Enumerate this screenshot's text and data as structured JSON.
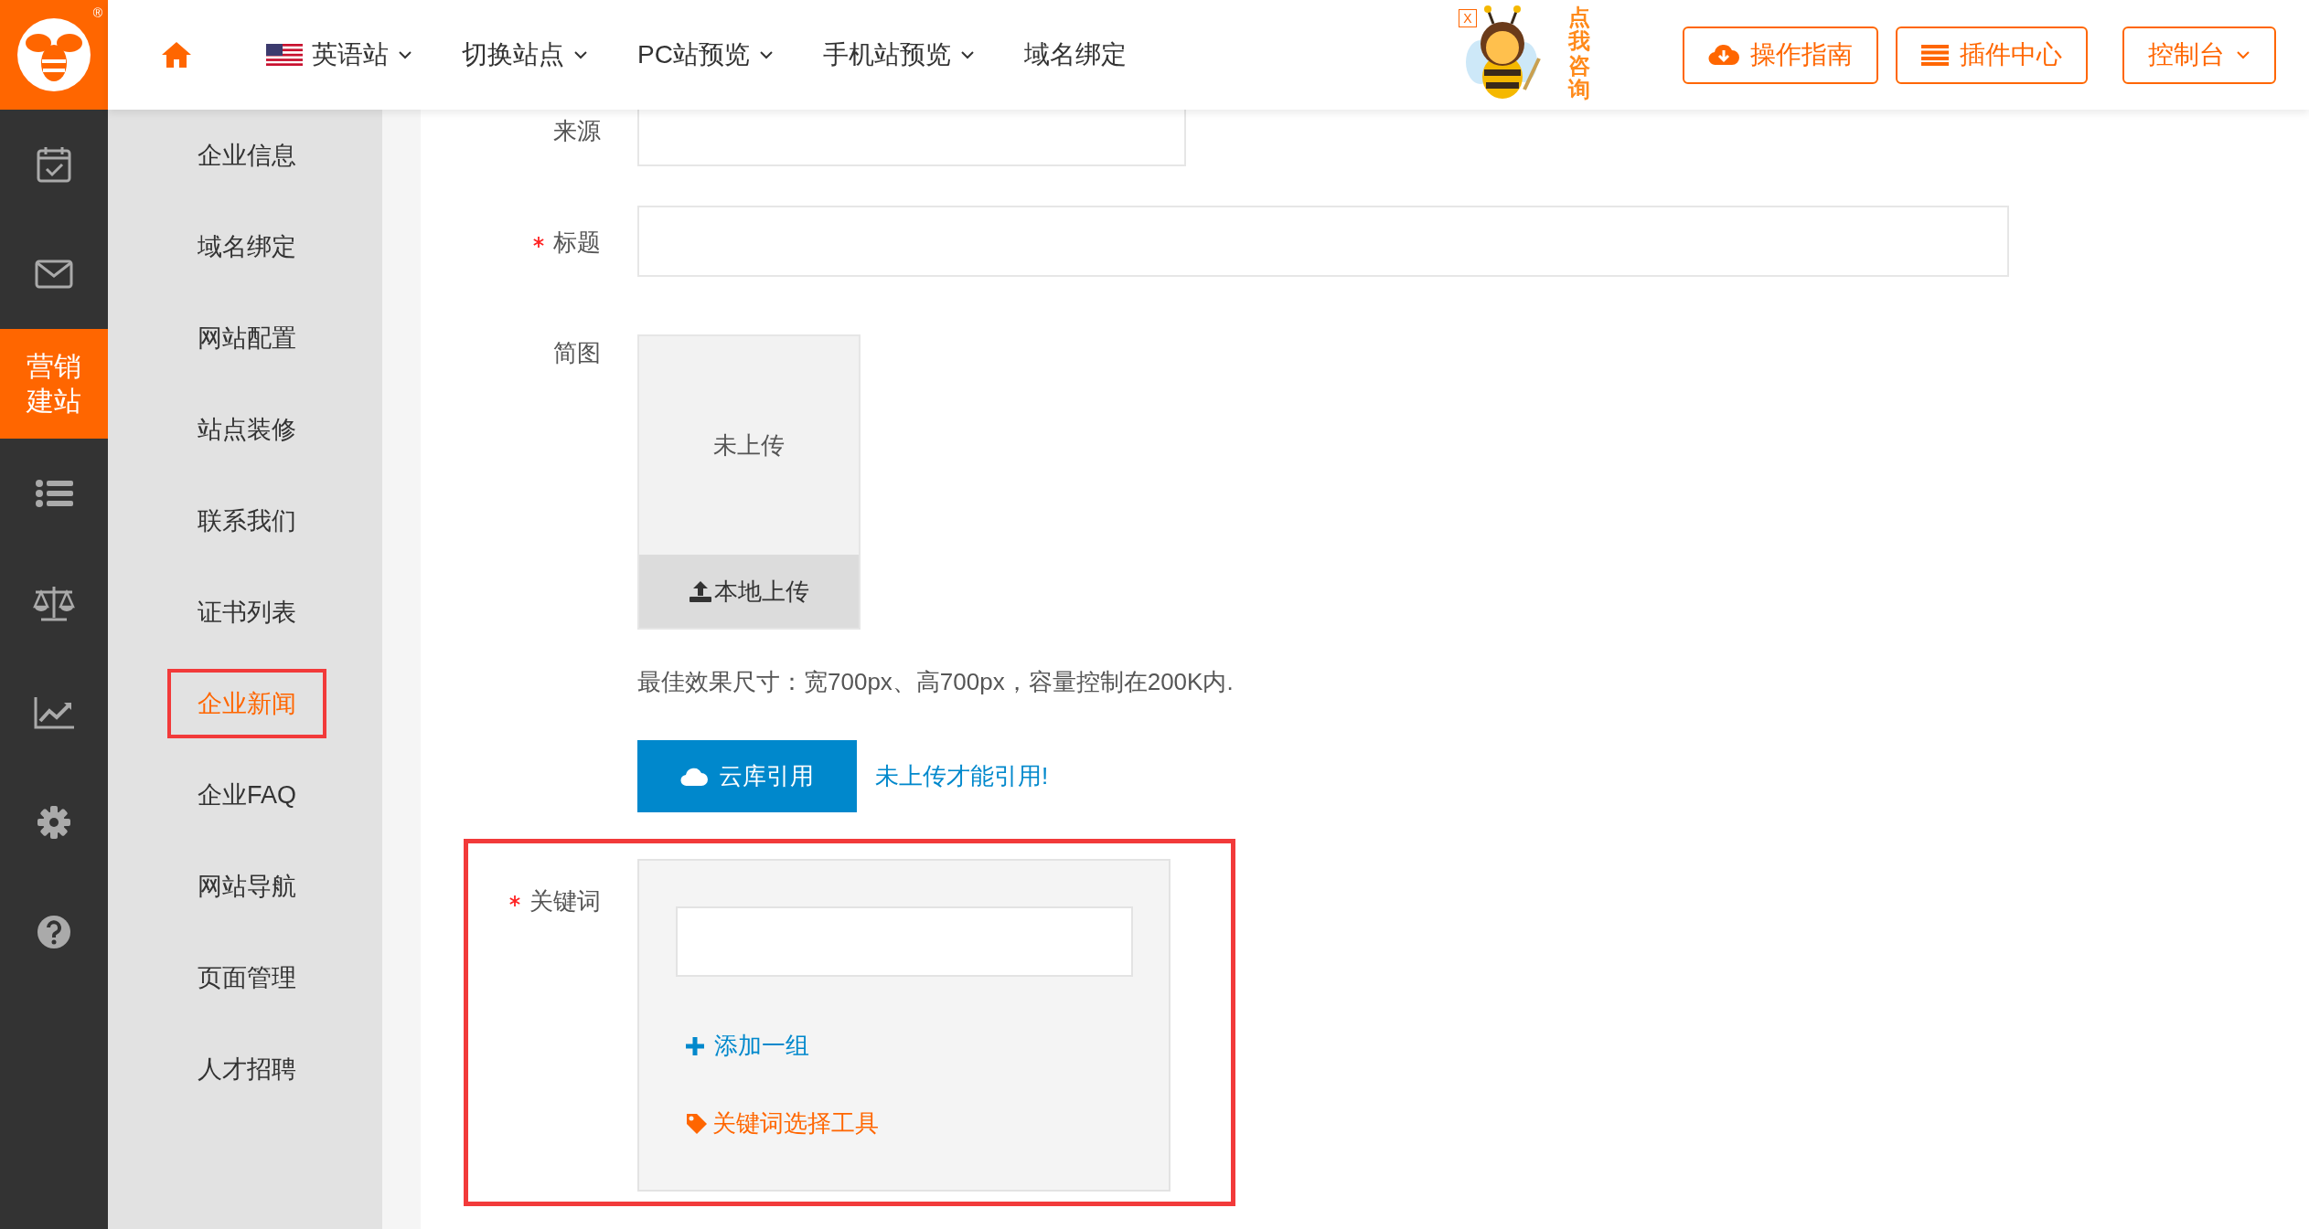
{
  "logo": {
    "mark": "®"
  },
  "rail": {
    "items": [
      {
        "selected": false
      },
      {
        "selected": false
      },
      {
        "label": "营销建站",
        "selected": true
      },
      {
        "selected": false
      },
      {
        "selected": false
      },
      {
        "selected": false
      },
      {
        "selected": false
      },
      {
        "selected": false
      }
    ]
  },
  "nav": {
    "items": [
      {
        "kind": "language",
        "label": "英语站",
        "dropdown": true
      },
      {
        "kind": "plain",
        "label": "切换站点",
        "dropdown": true
      },
      {
        "kind": "plain",
        "label": "PC站预览",
        "dropdown": true
      },
      {
        "kind": "plain",
        "label": "手机站预览",
        "dropdown": true
      },
      {
        "kind": "plain",
        "label": "域名绑定",
        "dropdown": false
      }
    ]
  },
  "consult_badge": {
    "close": "X",
    "text": "点我咨询"
  },
  "header_buttons": [
    {
      "label": "操作指南",
      "dropdown": false
    },
    {
      "label": "插件中心",
      "dropdown": false
    },
    {
      "label": "控制台",
      "dropdown": true
    }
  ],
  "sidebar": {
    "items": [
      {
        "label": "企业信息",
        "selected": false
      },
      {
        "label": "域名绑定",
        "selected": false
      },
      {
        "label": "网站配置",
        "selected": false
      },
      {
        "label": "站点装修",
        "selected": false
      },
      {
        "label": "联系我们",
        "selected": false
      },
      {
        "label": "证书列表",
        "selected": false
      },
      {
        "label": "企业新闻",
        "selected": true
      },
      {
        "label": "企业FAQ",
        "selected": false
      },
      {
        "label": "网站导航",
        "selected": false
      },
      {
        "label": "页面管理",
        "selected": false
      },
      {
        "label": "人才招聘",
        "selected": false
      }
    ]
  },
  "form": {
    "fields": [
      {
        "kind": "short",
        "label": "来源",
        "required": false,
        "highlighted": false
      },
      {
        "kind": "long",
        "label": "标题",
        "required": true,
        "highlighted": false
      },
      {
        "kind": "image",
        "label": "简图",
        "required": false,
        "highlighted": false,
        "empty_text": "未上传",
        "upload_button": "本地上传",
        "hint": "最佳效果尺寸：宽700px、高700px，容量控制在200K内.",
        "cloud_button": "云库引用",
        "cloud_note": "未上传才能引用!"
      },
      {
        "kind": "keywords",
        "label": "关键词",
        "required": true,
        "highlighted": true,
        "add_link": "添加一组",
        "tool_link": "关键词选择工具"
      }
    ]
  }
}
